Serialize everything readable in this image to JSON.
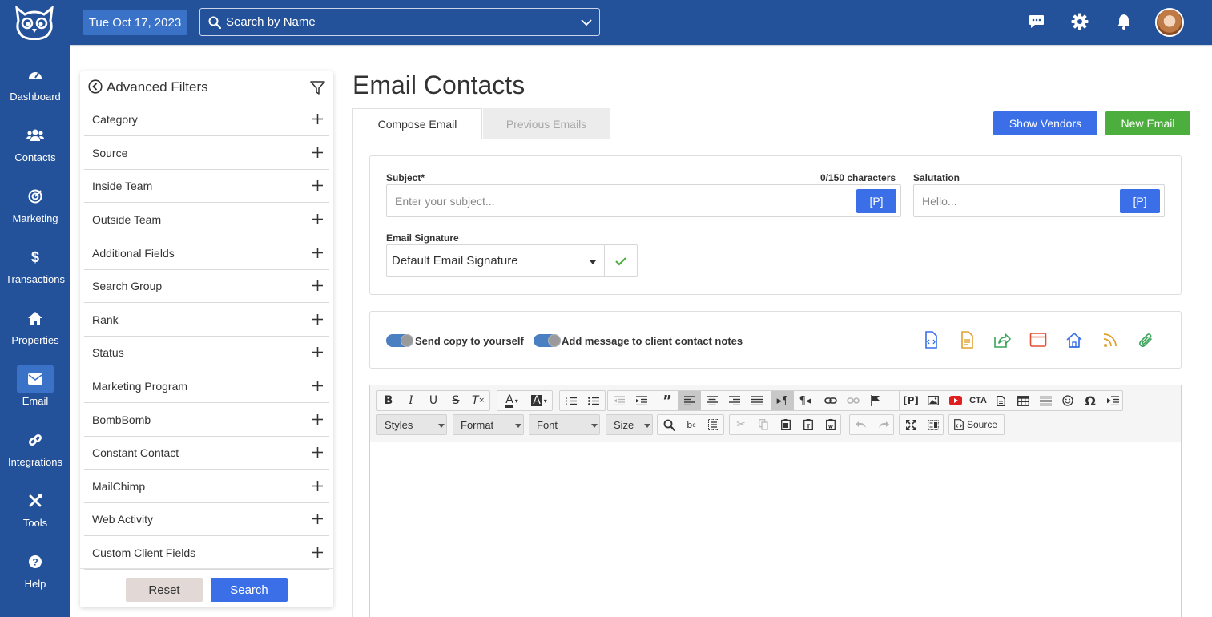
{
  "app": {
    "date": "Tue Oct 17, 2023",
    "search_placeholder": "Search by Name"
  },
  "nav": {
    "items": [
      {
        "label": "Dashboard",
        "icon": "gauge-icon"
      },
      {
        "label": "Contacts",
        "icon": "users-icon"
      },
      {
        "label": "Marketing",
        "icon": "bullseye-icon"
      },
      {
        "label": "Transactions",
        "icon": "dollar-icon"
      },
      {
        "label": "Properties",
        "icon": "home-icon"
      },
      {
        "label": "Email",
        "icon": "envelope-icon",
        "active": true
      },
      {
        "label": "Integrations",
        "icon": "link-icon"
      },
      {
        "label": "Tools",
        "icon": "tools-icon"
      },
      {
        "label": "Help",
        "icon": "help-icon"
      }
    ]
  },
  "filters": {
    "title": "Advanced Filters",
    "items": [
      "Category",
      "Source",
      "Inside Team",
      "Outside Team",
      "Additional Fields",
      "Search Group",
      "Rank",
      "Status",
      "Marketing Program",
      "BombBomb",
      "Constant Contact",
      "MailChimp",
      "Web Activity",
      "Custom Client Fields"
    ],
    "reset_label": "Reset",
    "search_label": "Search"
  },
  "main": {
    "title": "Email Contacts",
    "tabs": [
      "Compose Email",
      "Previous Emails"
    ],
    "show_vendors_label": "Show Vendors",
    "new_email_label": "New Email"
  },
  "compose": {
    "subject_label": "Subject*",
    "char_count": "0/150 characters",
    "subject_placeholder": "Enter your subject...",
    "placeholder_btn": "[P]",
    "salutation_label": "Salutation",
    "salutation_placeholder": "Hello...",
    "signature_label": "Email Signature",
    "signature_value": "Default Email Signature",
    "toggle_copy_label": "Send copy to yourself",
    "toggle_notes_label": "Add message to client contact notes"
  },
  "editor": {
    "combos": [
      "Styles",
      "Format",
      "Font",
      "Size"
    ],
    "source_label": "Source"
  },
  "colors": {
    "brand_navy": "#23529a",
    "accent_blue": "#3a6fe8",
    "success_green": "#4caf3d"
  }
}
